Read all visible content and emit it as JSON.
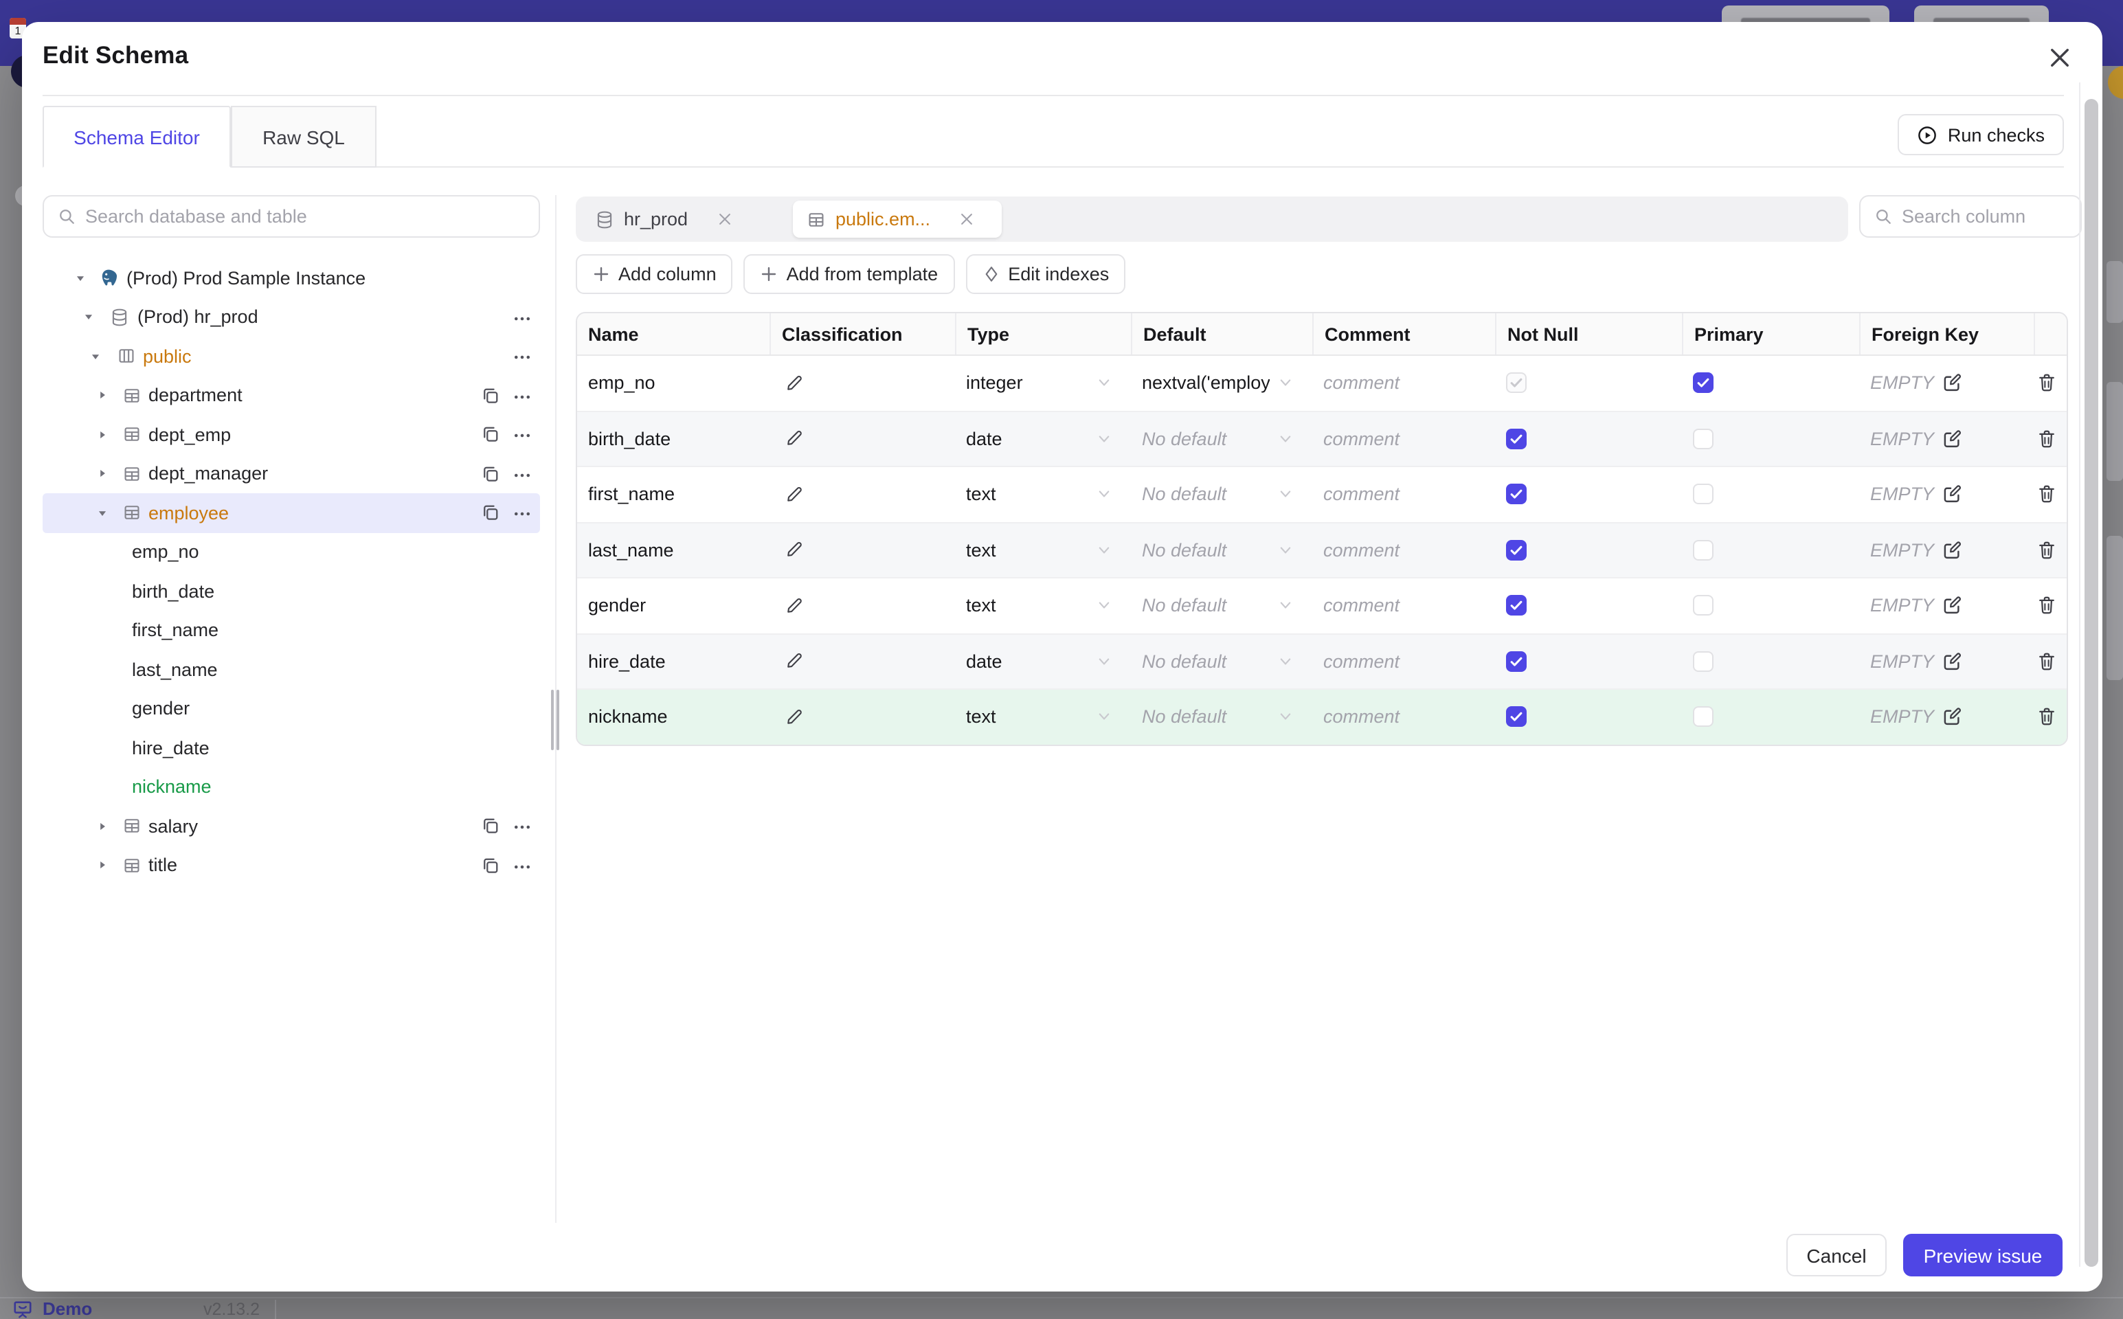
{
  "background": {
    "demo_label": "Demo",
    "version": "v2.13.2"
  },
  "modal": {
    "title": "Edit Schema"
  },
  "tabs": {
    "schema_editor": "Schema Editor",
    "raw_sql": "Raw SQL"
  },
  "actions": {
    "run_checks": "Run checks",
    "cancel": "Cancel",
    "preview_issue": "Preview issue"
  },
  "sidebar": {
    "search_placeholder": "Search database and table",
    "tree": [
      {
        "label": "(Prod) Prod Sample Instance",
        "type": "instance",
        "state": "expanded"
      },
      {
        "label": "(Prod) hr_prod",
        "type": "database",
        "state": "expanded"
      },
      {
        "label": "public",
        "type": "schema",
        "state": "expanded",
        "color": "amber"
      },
      {
        "label": "department",
        "type": "table",
        "state": "collapsed"
      },
      {
        "label": "dept_emp",
        "type": "table",
        "state": "collapsed"
      },
      {
        "label": "dept_manager",
        "type": "table",
        "state": "collapsed"
      },
      {
        "label": "employee",
        "type": "table",
        "state": "expanded",
        "color": "amber",
        "selected": true
      },
      {
        "label": "emp_no",
        "type": "column"
      },
      {
        "label": "birth_date",
        "type": "column"
      },
      {
        "label": "first_name",
        "type": "column"
      },
      {
        "label": "last_name",
        "type": "column"
      },
      {
        "label": "gender",
        "type": "column"
      },
      {
        "label": "hire_date",
        "type": "column"
      },
      {
        "label": "nickname",
        "type": "column",
        "color": "green"
      },
      {
        "label": "salary",
        "type": "table",
        "state": "collapsed"
      },
      {
        "label": "title",
        "type": "table",
        "state": "collapsed"
      }
    ]
  },
  "main": {
    "tabs": [
      {
        "label": "hr_prod",
        "icon": "database",
        "active": false
      },
      {
        "label": "public.em...",
        "icon": "table",
        "active": true
      }
    ],
    "search_placeholder": "Search column",
    "toolbar": {
      "add_column": "Add column",
      "add_from_template": "Add from template",
      "edit_indexes": "Edit indexes"
    },
    "table": {
      "headers": [
        "Name",
        "Classification",
        "Type",
        "Default",
        "Comment",
        "Not Null",
        "Primary",
        "Foreign Key"
      ],
      "default_placeholder": "No default",
      "comment_placeholder": "comment",
      "fk_empty": "EMPTY",
      "rows": [
        {
          "name": "emp_no",
          "type": "integer",
          "default": "nextval('employ",
          "not_null": true,
          "not_null_disabled": true,
          "primary": true,
          "highlight": ""
        },
        {
          "name": "birth_date",
          "type": "date",
          "default": "",
          "not_null": true,
          "primary": false,
          "highlight": ""
        },
        {
          "name": "first_name",
          "type": "text",
          "default": "",
          "not_null": true,
          "primary": false,
          "highlight": ""
        },
        {
          "name": "last_name",
          "type": "text",
          "default": "",
          "not_null": true,
          "primary": false,
          "highlight": ""
        },
        {
          "name": "gender",
          "type": "text",
          "default": "",
          "not_null": true,
          "primary": false,
          "highlight": ""
        },
        {
          "name": "hire_date",
          "type": "date",
          "default": "",
          "not_null": true,
          "primary": false,
          "highlight": ""
        },
        {
          "name": "nickname",
          "type": "text",
          "default": "",
          "not_null": true,
          "primary": false,
          "highlight": "created"
        }
      ]
    }
  },
  "colors": {
    "accent": "#4f46e5",
    "amber_changed": "#c9790e",
    "green_created": "#189a48",
    "app_header": "#3a3694",
    "created_row_bg": "#e7f6ed",
    "selected_tree_bg": "#e9eafc"
  }
}
